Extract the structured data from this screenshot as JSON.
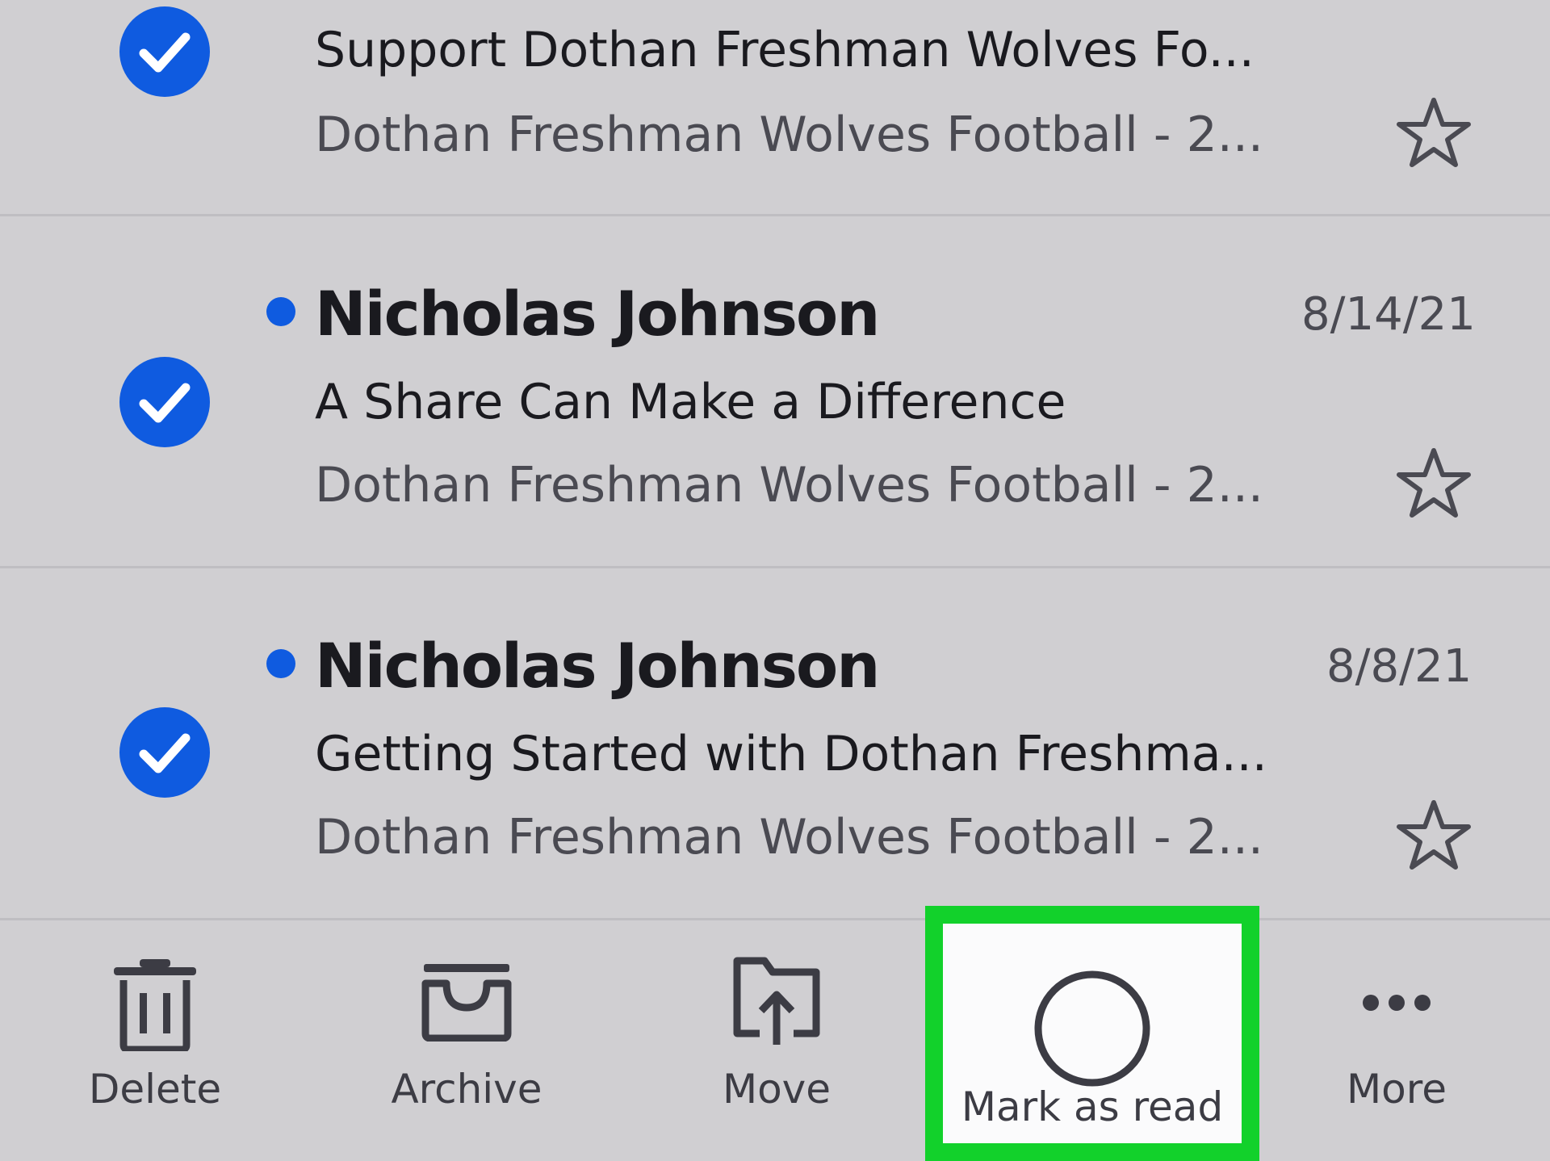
{
  "messages": [
    {
      "selected": true,
      "unread": false,
      "sender": "",
      "date": "",
      "subject": "Support Dothan Freshman Wolves Fo...",
      "preview": "Dothan Freshman Wolves Football - 2...",
      "starred": false
    },
    {
      "selected": true,
      "unread": true,
      "sender": "Nicholas Johnson",
      "date": "8/14/21",
      "subject": "A Share Can Make a Difference",
      "preview": "Dothan Freshman Wolves Football - 2...",
      "starred": false
    },
    {
      "selected": true,
      "unread": true,
      "sender": "Nicholas Johnson",
      "date": "8/8/21",
      "subject": "Getting Started with Dothan Freshma...",
      "preview": "Dothan Freshman Wolves Football - 2...",
      "starred": false
    }
  ],
  "toolbar": {
    "delete_label": "Delete",
    "archive_label": "Archive",
    "move_label": "Move",
    "mark_read_label": "Mark as read",
    "more_label": "More"
  },
  "colors": {
    "background": "#d0cfd2",
    "accent_blue": "#0f5be0",
    "highlight_green": "#12d12b",
    "text_dark": "#1a1a1f",
    "text_muted": "#4a4a52"
  },
  "icons": {
    "selected_check": "check-circle-icon",
    "unread": "unread-dot-icon",
    "star": "star-outline-icon",
    "delete": "trash-icon",
    "archive": "archive-box-icon",
    "move": "folder-upload-icon",
    "mark_read": "circle-outline-icon",
    "more": "more-dots-icon"
  }
}
